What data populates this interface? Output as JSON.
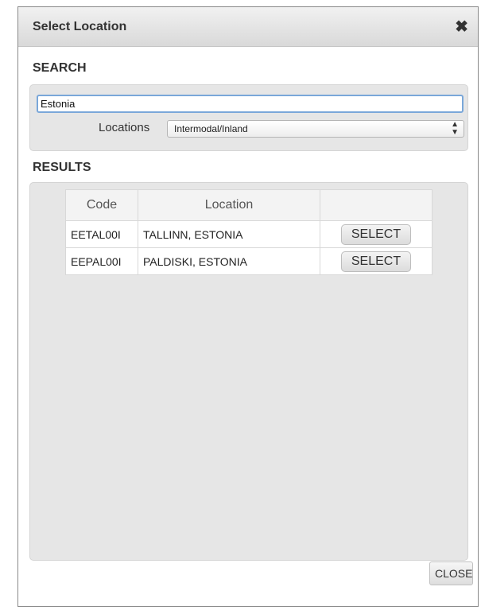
{
  "dialog": {
    "title": "Select Location",
    "close_icon": "close-x-icon"
  },
  "search": {
    "heading": "SEARCH",
    "query": "Estonia",
    "locations_label": "Locations",
    "locations_selected": "Intermodal/Inland"
  },
  "results": {
    "heading": "RESULTS",
    "columns": [
      "Code",
      "Location",
      ""
    ],
    "rows": [
      {
        "code": "EETAL00I",
        "location": "TALLINN, ESTONIA",
        "action": "SELECT"
      },
      {
        "code": "EEPAL00I",
        "location": "PALDISKI, ESTONIA",
        "action": "SELECT"
      }
    ]
  },
  "footer": {
    "close_label": "CLOSE"
  }
}
